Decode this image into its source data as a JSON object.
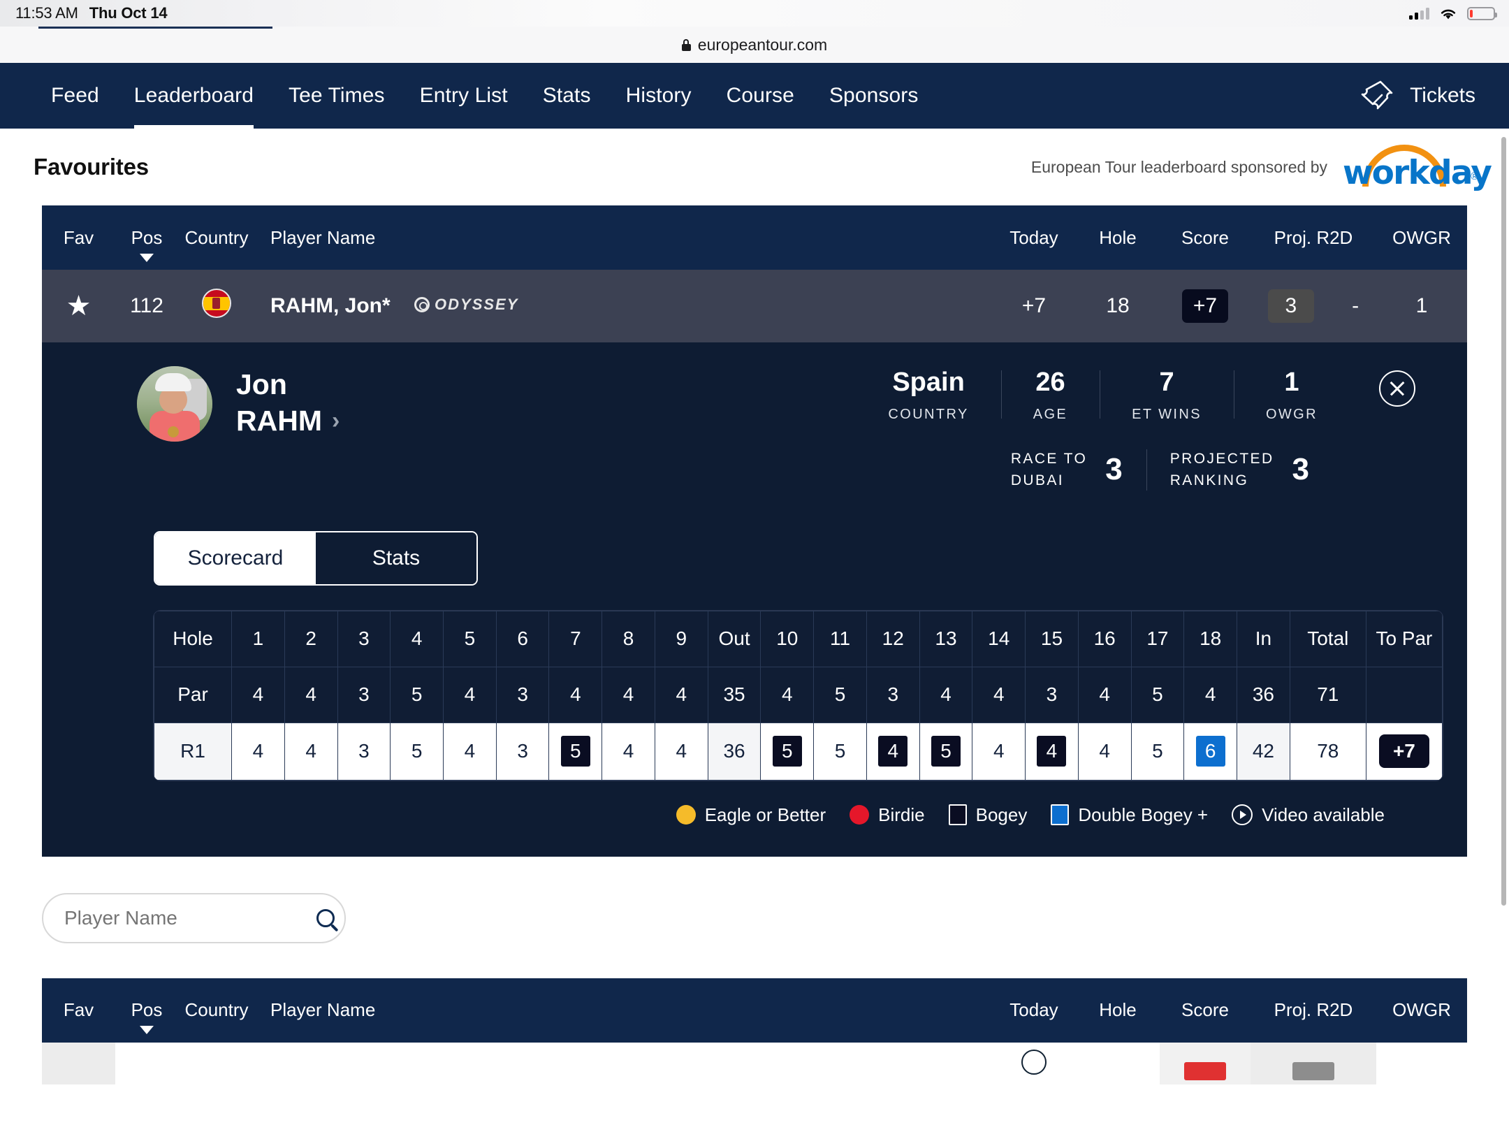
{
  "status_bar": {
    "time": "11:53 AM",
    "date": "Thu Oct 14",
    "signal_icon": "cellular-signal-icon",
    "wifi_icon": "wifi-icon",
    "battery_icon": "battery-low-icon"
  },
  "browser": {
    "url": "europeantour.com",
    "lock_icon": "lock-icon"
  },
  "nav": {
    "items": [
      {
        "label": "Feed",
        "active": false
      },
      {
        "label": "Leaderboard",
        "active": true
      },
      {
        "label": "Tee Times",
        "active": false
      },
      {
        "label": "Entry List",
        "active": false
      },
      {
        "label": "Stats",
        "active": false
      },
      {
        "label": "History",
        "active": false
      },
      {
        "label": "Course",
        "active": false
      },
      {
        "label": "Sponsors",
        "active": false
      }
    ],
    "tickets_label": "Tickets",
    "tickets_icon": "ticket-icon",
    "background": "#10274b"
  },
  "page": {
    "title": "Favourites",
    "sponsor_text": "European Tour leaderboard sponsored by",
    "sponsor_brand": "workday",
    "sponsor_registered": "®",
    "sponsor_blue": "#0875c9",
    "sponsor_orange": "#f29111"
  },
  "leaderboard": {
    "columns": [
      "Fav",
      "Pos",
      "Country",
      "Player Name",
      "Today",
      "Hole",
      "Score",
      "Proj. R2D",
      "OWGR"
    ],
    "sort_indicator": "chevron-down-icon",
    "row": {
      "fav_icon": "star-filled-icon",
      "pos": "112",
      "country_icon": "flag-spain-icon",
      "name": "RAHM, Jon*",
      "sponsor_logo": "odyssey-logo",
      "sponsor_logo_text": "ODYSSEY",
      "today": "+7",
      "hole": "18",
      "score": "+7",
      "proj_r2d": "3",
      "proj_r2d_second": "-",
      "owgr": "1"
    }
  },
  "detail": {
    "avatar_icon": "player-photo-avatar",
    "first_name": "Jon",
    "last_name": "RAHM",
    "name_chevron": "chevron-right-icon",
    "close_icon": "close-circle-icon",
    "stats": [
      {
        "value": "Spain",
        "label": "COUNTRY"
      },
      {
        "value": "26",
        "label": "AGE"
      },
      {
        "value": "7",
        "label": "ET WINS"
      },
      {
        "value": "1",
        "label": "OWGR"
      }
    ],
    "rankings": [
      {
        "label_line1": "RACE TO",
        "label_line2": "DUBAI",
        "value": "3"
      },
      {
        "label_line1": "PROJECTED",
        "label_line2": "RANKING",
        "value": "3"
      }
    ],
    "tabs": [
      {
        "label": "Scorecard",
        "active": true
      },
      {
        "label": "Stats",
        "active": false
      }
    ]
  },
  "scorecard": {
    "row_labels": {
      "hole": "Hole",
      "par": "Par",
      "round": "R1"
    },
    "columns": [
      "1",
      "2",
      "3",
      "4",
      "5",
      "6",
      "7",
      "8",
      "9",
      "Out",
      "10",
      "11",
      "12",
      "13",
      "14",
      "15",
      "16",
      "17",
      "18",
      "In",
      "Total",
      "To Par"
    ],
    "par": [
      "4",
      "4",
      "3",
      "5",
      "4",
      "3",
      "4",
      "4",
      "4",
      "35",
      "4",
      "5",
      "3",
      "4",
      "4",
      "3",
      "4",
      "5",
      "4",
      "36",
      "71",
      ""
    ],
    "round": [
      "4",
      "4",
      "3",
      "5",
      "4",
      "3",
      "5",
      "4",
      "4",
      "36",
      "5",
      "5",
      "4",
      "5",
      "4",
      "4",
      "4",
      "5",
      "6",
      "42",
      "78",
      "+7"
    ],
    "marks": [
      "",
      "",
      "",
      "",
      "",
      "",
      "bogey",
      "",
      "",
      "sum",
      "bogey",
      "",
      "bogey",
      "bogey",
      "",
      "bogey",
      "",
      "",
      "dbl",
      "sum",
      "",
      "topar"
    ],
    "legend": [
      {
        "label": "Eagle or Better",
        "shape": "circle",
        "color": "#f5bb2a",
        "icon": "eagle-legend-icon"
      },
      {
        "label": "Birdie",
        "shape": "circle",
        "color": "#e5172a",
        "icon": "birdie-legend-icon"
      },
      {
        "label": "Bogey",
        "shape": "square",
        "color": "#0a0d22",
        "icon": "bogey-legend-icon"
      },
      {
        "label": "Double Bogey +",
        "shape": "square",
        "color": "#0d6fcf",
        "icon": "double-bogey-legend-icon"
      },
      {
        "label": "Video available",
        "shape": "play",
        "color": "#ffffff",
        "icon": "video-play-icon"
      }
    ]
  },
  "search": {
    "placeholder": "Player Name",
    "value": "",
    "icon": "search-icon"
  },
  "bottom_table": {
    "columns": [
      "Fav",
      "Pos",
      "Country",
      "Player Name",
      "Today",
      "Hole",
      "Score",
      "Proj. R2D",
      "OWGR"
    ],
    "sort_indicator": "chevron-down-icon"
  }
}
